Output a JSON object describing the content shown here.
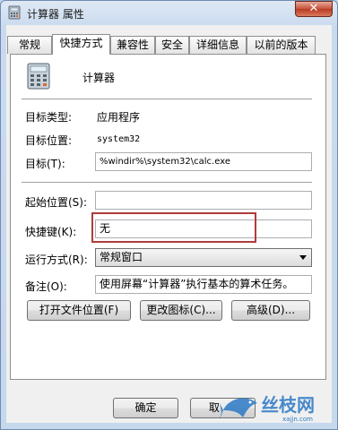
{
  "window": {
    "title": "计算器 属性",
    "close_glyph": "✕"
  },
  "tabs": [
    {
      "label": "常规"
    },
    {
      "label": "快捷方式",
      "active": true
    },
    {
      "label": "兼容性"
    },
    {
      "label": "安全"
    },
    {
      "label": "详细信息"
    },
    {
      "label": "以前的版本"
    }
  ],
  "app": {
    "name": "计算器",
    "icon": "calculator-icon"
  },
  "info": {
    "target_type_label": "目标类型:",
    "target_type_value": "应用程序",
    "target_location_label": "目标位置:",
    "target_location_value": "system32",
    "target_label": "目标(T):",
    "target_value": "%windir%\\system32\\calc.exe"
  },
  "fields": {
    "start_in_label": "起始位置(S):",
    "start_in_value": "",
    "hotkey_label": "快捷键(K):",
    "hotkey_value": "无",
    "run_label": "运行方式(R):",
    "run_value": "常规窗口",
    "comment_label": "备注(O):",
    "comment_value": "使用屏幕“计算器”执行基本的算术任务。"
  },
  "buttons": {
    "open_location": "打开文件位置(F)",
    "change_icon": "更改图标(C)...",
    "advanced": "高级(D)...",
    "ok": "确定",
    "cancel": "取"
  },
  "watermark": {
    "text": "丝枝网",
    "url": "xajjn.com"
  },
  "colors": {
    "highlight": "#b03b3b",
    "title_bar": "#c9daee",
    "close_button": "#c7513a"
  }
}
